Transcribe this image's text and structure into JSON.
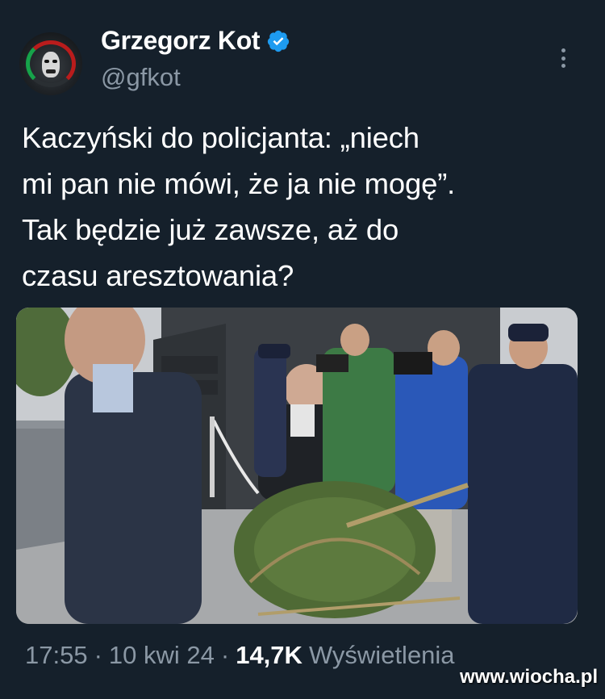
{
  "author": {
    "display_name": "Grzegorz Kot",
    "handle": "@gfkot",
    "verified": true,
    "avatar_icon": "avatar-image"
  },
  "tweet": {
    "text": "Kaczyński do policjanta: „niech\nmi pan nie mówi, że ja nie mogę”.\nTak będzie już zawsze, aż  do\nczasu aresztowania?",
    "media_description_icon": "photo"
  },
  "meta": {
    "time": "17:55",
    "separator": "·",
    "date": "10 kwi 24",
    "views_count": "14,7K",
    "views_label": "Wyświetlenia"
  },
  "watermark": "www.wiocha.pl",
  "colors": {
    "background": "#15202b",
    "text": "#ffffff",
    "secondary_text": "#8b98a5",
    "verified": "#1d9bf0"
  }
}
